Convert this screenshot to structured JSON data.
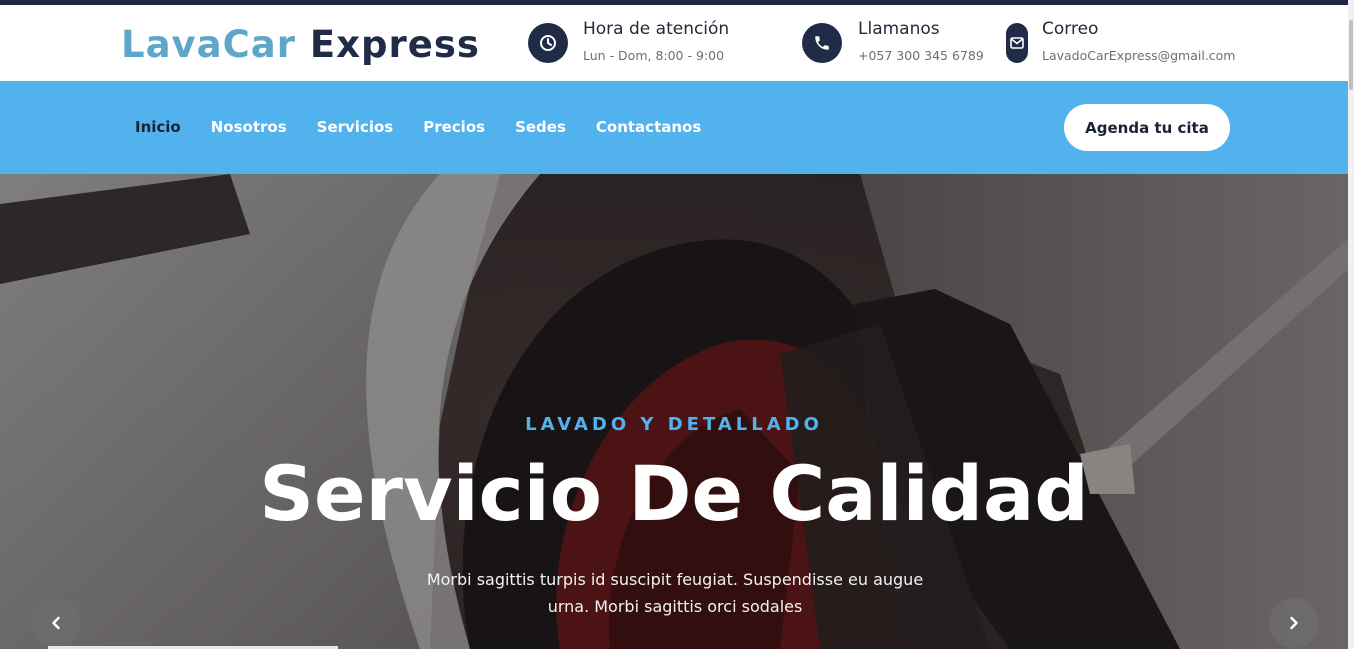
{
  "brand": {
    "part1": "LavaCar",
    "part2": "Express",
    "color1": "#5fa7c9",
    "color2": "#1f2b47"
  },
  "contact": [
    {
      "icon": "clock-icon",
      "title": "Hora de atención",
      "detail": "Lun - Dom, 8:00 - 9:00"
    },
    {
      "icon": "phone-icon",
      "title": "Llamanos",
      "detail": "+057 300 345 6789"
    },
    {
      "icon": "envelope-icon",
      "title": "Correo",
      "detail": "LavadoCarExpress@gmail.com"
    }
  ],
  "nav": {
    "items": [
      {
        "label": "Inicio",
        "active": true
      },
      {
        "label": "Nosotros",
        "active": false
      },
      {
        "label": "Servicios",
        "active": false
      },
      {
        "label": "Precios",
        "active": false
      },
      {
        "label": "Sedes",
        "active": false
      },
      {
        "label": "Contactanos",
        "active": false
      }
    ],
    "cta": "Agenda tu cita",
    "background": "#51b2ed"
  },
  "hero": {
    "eyebrow": "LAVADO Y DETALLADO",
    "headline": "Servicio De Calidad",
    "lead": "Morbi sagittis turpis id suscipit feugiat. Suspendisse eu augue urna. Morbi sagittis orci sodales",
    "prev_icon": "chevron-left-icon",
    "next_icon": "chevron-right-icon",
    "accent": "#51b2ed"
  }
}
